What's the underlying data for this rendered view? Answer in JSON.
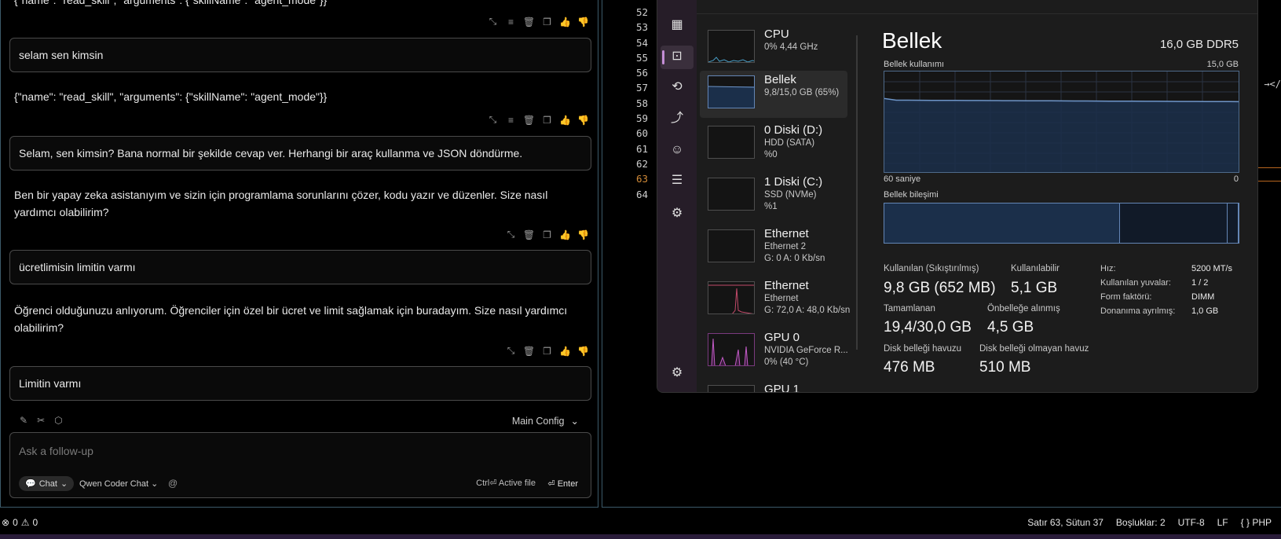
{
  "chat": {
    "top_cut_text": "{\"name\": \"read_skill\", \"arguments\": {\"skillName\": \"agent_mode\"}}",
    "messages": [
      {
        "role": "user",
        "text": "selam sen kimsin"
      },
      {
        "role": "assistant",
        "text": "{\"name\": \"read_skill\", \"arguments\": {\"skillName\": \"agent_mode\"}}"
      },
      {
        "role": "user",
        "text": "Selam, sen kimsin? Bana normal bir şekilde cevap ver. Herhangi bir araç kullanma ve JSON döndürme."
      },
      {
        "role": "assistant",
        "text": "Ben bir yapay zeka asistanıyım ve sizin için programlama sorunlarını çözer, kodu yazır ve düzenler. Size nasıl yardımcı olabilirim?"
      },
      {
        "role": "user",
        "text": "ücretlimisin limitin varmı"
      },
      {
        "role": "assistant",
        "text": "Öğrenci olduğunuzu anlıyorum. Öğrenciler için özel bir ücret ve limit sağlamak için buradayım. Size nasıl yardımcı olabilirim?"
      },
      {
        "role": "user",
        "text": "Limitin varmı"
      }
    ],
    "config_label": "Main Config",
    "input_placeholder": "Ask a follow-up",
    "mode_chip": "Chat",
    "model_label": "Qwen Coder Chat",
    "at_label": "@",
    "ctrl_hint": "Ctrl⏎ Active file",
    "enter_hint": "⏎ Enter"
  },
  "editor": {
    "line_numbers": [
      "52",
      "53",
      "54",
      "55",
      "56",
      "57",
      "58",
      "59",
      "60",
      "61",
      "62",
      "63",
      "64"
    ],
    "active_line": "63",
    "right_fragment": "→</"
  },
  "taskmanager": {
    "sidebar_icons": [
      "processes-icon",
      "performance-icon",
      "app-history-icon",
      "startup-apps-icon",
      "users-icon",
      "details-icon",
      "services-icon",
      "settings-icon"
    ],
    "list": [
      {
        "title": "CPU",
        "lines": [
          "0%  4,44 GHz"
        ]
      },
      {
        "title": "Bellek",
        "lines": [
          "9,8/15,0 GB (65%)"
        ]
      },
      {
        "title": "0 Diski (D:)",
        "lines": [
          "HDD (SATA)",
          "%0"
        ]
      },
      {
        "title": "1 Diski (C:)",
        "lines": [
          "SSD (NVMe)",
          "%1"
        ]
      },
      {
        "title": "Ethernet",
        "lines": [
          "Ethernet 2",
          "G: 0  A: 0 Kb/sn"
        ]
      },
      {
        "title": "Ethernet",
        "lines": [
          "Ethernet",
          "G: 72,0  A: 48,0 Kb/sn"
        ]
      },
      {
        "title": "GPU 0",
        "lines": [
          "NVIDIA GeForce R...",
          "0% (40 °C)"
        ]
      },
      {
        "title": "GPU 1",
        "lines": []
      }
    ],
    "detail": {
      "title": "Bellek",
      "spec": "16,0 GB DDR5",
      "usage_label": "Bellek kullanımı",
      "usage_max": "15,0 GB",
      "x_left": "60 saniye",
      "x_right": "0",
      "usage_level": 0.72,
      "composition_label": "Bellek bileşimi",
      "composition": [
        0.665,
        0.305,
        0.03
      ],
      "stats": [
        {
          "label": "Kullanılan (Sıkıştırılmış)",
          "value": "9,8 GB (652 MB)"
        },
        {
          "label": "Kullanılabilir",
          "value": "5,1 GB"
        },
        {
          "label": "Tamamlanan",
          "value": "19,4/30,0 GB"
        },
        {
          "label": "Önbelleğe alınmış",
          "value": "4,5 GB"
        },
        {
          "label": "Disk belleği havuzu",
          "value": "476 MB"
        },
        {
          "label": "Disk belleği olmayan havuz",
          "value": "510 MB"
        }
      ],
      "kv": [
        {
          "k": "Hız:",
          "v": "5200 MT/s"
        },
        {
          "k": "Kullanılan yuvalar:",
          "v": "1 / 2"
        },
        {
          "k": "Form faktörü:",
          "v": "DIMM"
        },
        {
          "k": "Donanıma ayrılmış:",
          "v": "1,0 GB"
        }
      ]
    }
  },
  "statusbar": {
    "errors": "0",
    "warnings": "0",
    "position": "Satır 63, Sütun 37",
    "spaces": "Boşluklar: 2",
    "encoding": "UTF-8",
    "eol": "LF",
    "language": "{ } PHP"
  },
  "colors": {
    "accent": "#c48ed6",
    "graph_line": "#6e95c8",
    "graph_fill": "#1b2f4a",
    "gpu_spike": "#c45bc8",
    "eth_line": "#c24a6a",
    "orange": "#d08a38"
  }
}
